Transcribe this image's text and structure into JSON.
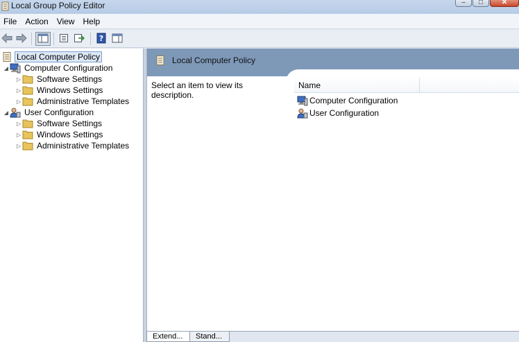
{
  "window": {
    "title": "Local Group Policy Editor",
    "buttons": {
      "minimize": "–",
      "maximize": "□",
      "close": "✕"
    }
  },
  "menu": [
    "File",
    "Action",
    "View",
    "Help"
  ],
  "toolbar": {
    "icons": [
      "back-arrow-icon",
      "forward-arrow-icon",
      "show-hide-console-tree-icon",
      "properties-icon",
      "export-list-icon",
      "help-icon",
      "show-action-pane-icon"
    ]
  },
  "tree": {
    "root": "Local Computer Policy",
    "items": [
      {
        "label": "Computer Configuration",
        "level": 1
      },
      {
        "label": "Software Settings",
        "level": 2
      },
      {
        "label": "Windows Settings",
        "level": 2
      },
      {
        "label": "Administrative Templates",
        "level": 2
      },
      {
        "label": "User Configuration",
        "level": 1
      },
      {
        "label": "Software Settings",
        "level": 2
      },
      {
        "label": "Windows Settings",
        "level": 2
      },
      {
        "label": "Administrative Templates",
        "level": 2
      }
    ]
  },
  "details": {
    "header_title": "Local Computer Policy",
    "description": "Select an item to view its description.",
    "columns": [
      "Name"
    ],
    "rows": [
      "Computer Configuration",
      "User Configuration"
    ]
  },
  "tabs": [
    "Extend...",
    "Stand..."
  ],
  "colors": {
    "header_band": "#7e98b8",
    "folder": "#e8c45c",
    "selection": "#dce8f6"
  }
}
